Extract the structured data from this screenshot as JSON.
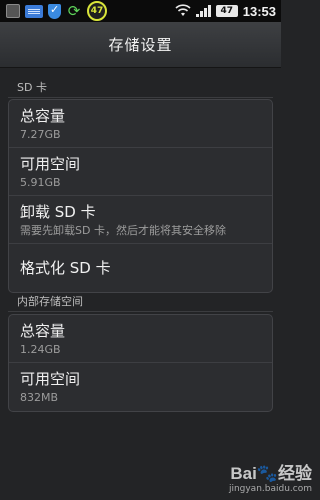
{
  "status_bar": {
    "notification_badge": "47",
    "battery": "47",
    "time": "13:53"
  },
  "header": {
    "title": "存储设置"
  },
  "sd_section": {
    "header": "SD 卡",
    "total": {
      "label": "总容量",
      "value": "7.27GB"
    },
    "available": {
      "label": "可用空间",
      "value": "5.91GB"
    },
    "unmount": {
      "label": "卸载 SD 卡",
      "summary": "需要先卸载SD 卡，然后才能将其安全移除"
    },
    "format": {
      "label": "格式化 SD 卡"
    }
  },
  "internal_section": {
    "header": "内部存储空间",
    "total": {
      "label": "总容量",
      "value": "1.24GB"
    },
    "available": {
      "label": "可用空间",
      "value": "832MB"
    }
  },
  "watermark": {
    "text": "Bai",
    "suffix": "经验",
    "url": "jingyan.baidu.com"
  }
}
